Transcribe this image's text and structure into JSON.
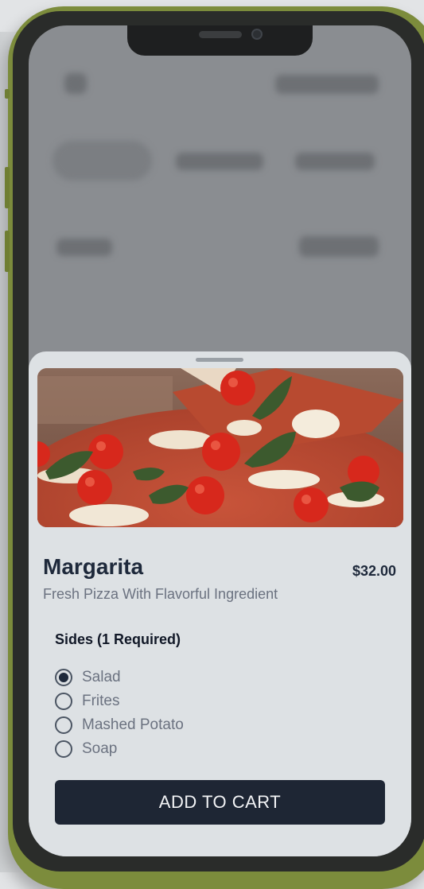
{
  "product": {
    "name": "Margarita",
    "price": "$32.00",
    "description": "Fresh Pizza With Flavorful Ingredient"
  },
  "sides": {
    "heading": "Sides (1 Required)",
    "options": [
      {
        "label": "Salad",
        "selected": true
      },
      {
        "label": "Frites",
        "selected": false
      },
      {
        "label": "Mashed Potato",
        "selected": false
      },
      {
        "label": "Soap",
        "selected": false
      }
    ]
  },
  "actions": {
    "add_to_cart": "ADD TO CART"
  },
  "colors": {
    "frame": "#7c8c3c",
    "sheet": "#dde1e4",
    "primary": "#1e2634",
    "text_dark": "#1e293b",
    "text_muted": "#6b7280"
  },
  "icons": {
    "hero_image": "pizza-photo",
    "radio_selected": "radio-checked-icon",
    "radio_unselected": "radio-unchecked-icon"
  }
}
